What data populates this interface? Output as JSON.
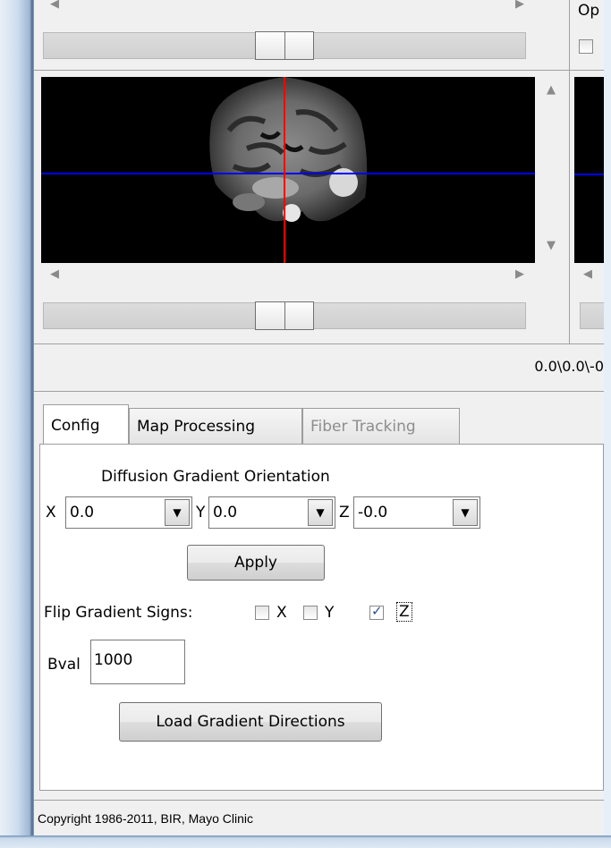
{
  "colors": {
    "crosshair_vertical": "#ff0000",
    "crosshair_horizontal": "#0000ff",
    "viewer_background": "#000000"
  },
  "top_panel": {
    "partial_label": "Op"
  },
  "status_bar": {
    "coordinates_text": "0.0\\0.0\\-0"
  },
  "tabs": [
    {
      "label": "Config",
      "state": "active"
    },
    {
      "label": "Map Processing",
      "state": "normal"
    },
    {
      "label": "Fiber Tracking",
      "state": "disabled"
    }
  ],
  "config": {
    "section_title": "Diffusion Gradient Orientation",
    "x_label": "X",
    "x_value": "0.0",
    "y_label": "Y",
    "y_value": "0.0",
    "z_label": "Z",
    "z_value": "-0.0",
    "apply_label": "Apply",
    "flip_label": "Flip Gradient Signs:",
    "flip_x_label": "X",
    "flip_x_checked": false,
    "flip_y_label": "Y",
    "flip_y_checked": false,
    "flip_z_label": "Z",
    "flip_z_checked": true,
    "bval_label": "Bval",
    "bval_value": "1000",
    "load_button_label": "Load Gradient Directions"
  },
  "footer": {
    "copyright": "Copyright 1986-2011, BIR, Mayo Clinic"
  }
}
